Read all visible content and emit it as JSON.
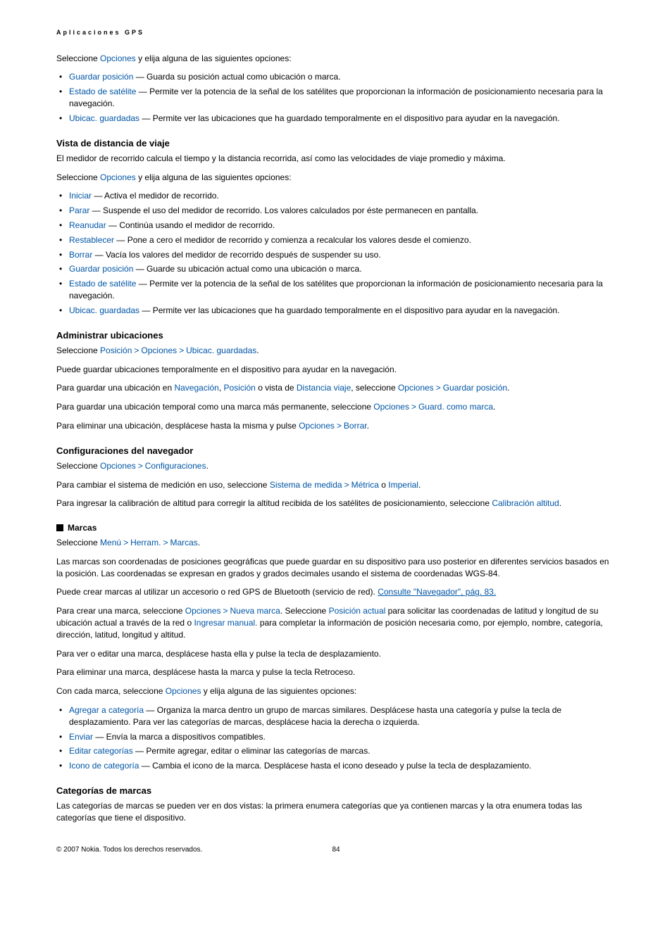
{
  "header": {
    "breadcrumb": "Aplicaciones GPS"
  },
  "intro": {
    "p1a": "Seleccione ",
    "opciones": "Opciones",
    "p1b": " y elija alguna de las siguientes opciones:",
    "items": [
      {
        "term": "Guardar posición",
        "rest": " — Guarda su posición actual como ubicación o marca."
      },
      {
        "term": "Estado de satélite",
        "rest": " — Permite ver la potencia de la señal de los satélites que proporcionan la información de posicionamiento necesaria para la navegación."
      },
      {
        "term": "Ubicac. guardadas",
        "rest": " — Permite ver las ubicaciones que ha guardado temporalmente en el dispositivo para ayudar en la navegación."
      }
    ]
  },
  "vista": {
    "title": "Vista de distancia de viaje",
    "desc": "El medidor de recorrido calcula el tiempo y la distancia recorrida, así como las velocidades de viaje promedio y máxima.",
    "sel_a": "Seleccione ",
    "sel_term": "Opciones",
    "sel_b": " y elija alguna de las siguientes opciones:",
    "items": [
      {
        "term": "Iniciar",
        "rest": " — Activa el medidor de recorrido."
      },
      {
        "term": "Parar",
        "rest": " — Suspende el uso del medidor de recorrido. Los valores calculados por éste permanecen en pantalla."
      },
      {
        "term": "Reanudar",
        "rest": " — Continúa usando el medidor de recorrido."
      },
      {
        "term": "Restablecer",
        "rest": " — Pone a cero el medidor de recorrido y comienza a recalcular los valores desde el comienzo."
      },
      {
        "term": "Borrar",
        "rest": " — Vacía los valores del medidor de recorrido después de suspender su uso."
      },
      {
        "term": "Guardar posición",
        "rest": " — Guarde su ubicación actual como una ubicación o marca."
      },
      {
        "term": "Estado de satélite",
        "rest": " — Permite ver la potencia de la señal de los satélites que proporcionan la información de posicionamiento necesaria para la navegación."
      },
      {
        "term": "Ubicac. guardadas",
        "rest": " — Permite ver las ubicaciones que ha guardado temporalmente en el dispositivo para ayudar en la navegación."
      }
    ]
  },
  "admin": {
    "title": "Administrar ubicaciones",
    "sel": "Seleccione ",
    "posicion": "Posición",
    "opciones": "Opciones",
    "ubicac": "Ubicac. guardadas",
    "p2": "Puede guardar ubicaciones temporalmente en el dispositivo para ayudar en la navegación.",
    "p3a": "Para guardar una ubicación en ",
    "navegacion": "Navegación",
    "comma1": ", ",
    "posicion2": "Posición",
    "p3b": " o vista de ",
    "distancia": "Distancia viaje",
    "p3c": ", seleccione ",
    "opciones2": "Opciones",
    "guardar_pos": "Guardar posición",
    "p4a": "Para guardar una ubicación temporal como una marca más permanente, seleccione ",
    "opciones3": "Opciones",
    "guard_como": "Guard. como marca",
    "p5a": "Para eliminar una ubicación, desplácese hasta la misma y pulse ",
    "opciones4": "Opciones",
    "borrar": "Borrar"
  },
  "config": {
    "title": "Configuraciones del navegador",
    "sel": "Seleccione ",
    "opciones": "Opciones",
    "configs": "Configuraciones",
    "p2a": "Para cambiar el sistema de medición en uso, seleccione ",
    "sistema": "Sistema de medida",
    "metrica": "Métrica",
    "p2b": " o ",
    "imperial": "Imperial",
    "p3a": "Para ingresar la calibración de altitud para corregir la altitud recibida de los satélites de posicionamiento, seleccione ",
    "calibracion": "Calibración altitud"
  },
  "marcas": {
    "title": "Marcas",
    "sel": "Seleccione ",
    "menu": "Menú",
    "herram": "Herram.",
    "marcas_term": "Marcas",
    "p2": "Las marcas son coordenadas de posiciones geográficas que puede guardar en su dispositivo para uso posterior en diferentes servicios basados en la posición. Las coordenadas se expresan en grados y grados decimales usando el sistema de coordenadas WGS-84.",
    "p3a": "Puede crear marcas al utilizar un accesorio o red GPS de Bluetooth (servicio de red). ",
    "p3link": "Consulte \"Navegador\", pág. 83.",
    "p4a": "Para crear una marca, seleccione ",
    "opciones": "Opciones",
    "nueva_marca": "Nueva marca",
    "p4b": ". Seleccione ",
    "posicion_actual": "Posición actual",
    "p4c": " para solicitar las coordenadas de latitud y longitud de su ubicación actual a través de la red o ",
    "ingresar_manual": "Ingresar manual.",
    "p4d": " para completar la información de posición necesaria como, por ejemplo, nombre, categoría, dirección, latitud, longitud y altitud.",
    "p5": "Para ver o editar una marca, desplácese hasta ella y pulse la tecla de desplazamiento.",
    "p6": "Para eliminar una marca, desplácese hasta la marca y pulse la tecla Retroceso.",
    "p7a": "Con cada marca, seleccione ",
    "opciones2": "Opciones",
    "p7b": " y elija alguna de las siguientes opciones:",
    "items": [
      {
        "term": "Agregar a categoría",
        "rest": " — Organiza la marca dentro un grupo de marcas similares. Desplácese hasta una categoría y pulse la tecla de desplazamiento. Para ver las categorías de marcas, desplácese hacia la derecha o izquierda."
      },
      {
        "term": "Enviar",
        "rest": " — Envía la marca a dispositivos compatibles."
      },
      {
        "term": "Editar categorías",
        "rest": " — Permite agregar, editar o eliminar las categorías de marcas."
      },
      {
        "term": "Icono de categoría",
        "rest": " — Cambia el icono de la marca. Desplácese hasta el icono deseado y pulse la tecla de desplazamiento."
      }
    ]
  },
  "categorias": {
    "title": "Categorías de marcas",
    "p1": "Las categorías de marcas se pueden ver en dos vistas: la primera enumera categorías que ya contienen marcas y la otra enumera todas las categorías que tiene el dispositivo."
  },
  "footer": {
    "copyright": "© 2007 Nokia. Todos los derechos reservados.",
    "page": "84"
  },
  "sep": ">"
}
